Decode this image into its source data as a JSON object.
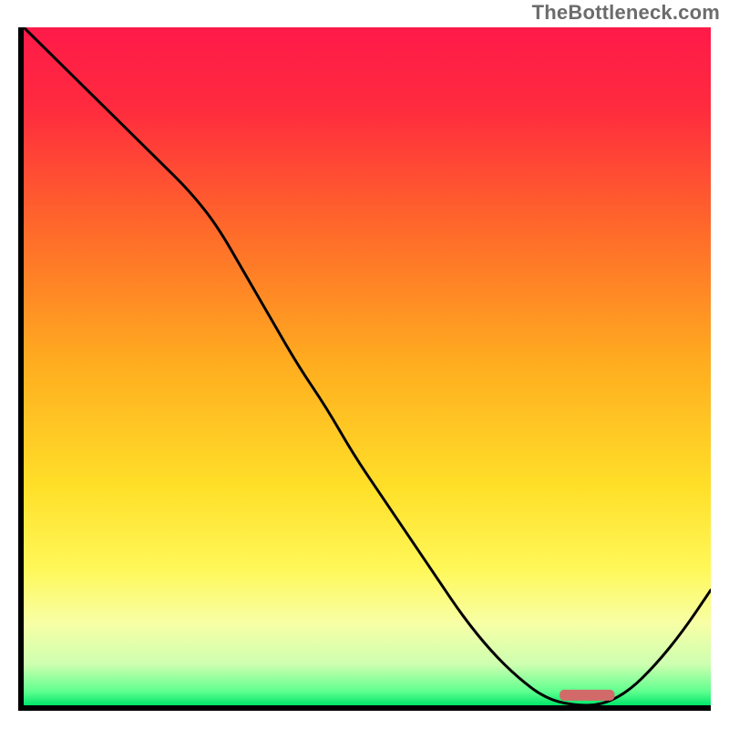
{
  "watermark": "TheBottleneck.com",
  "chart_data": {
    "type": "line",
    "title": "",
    "xlabel": "",
    "ylabel": "",
    "xlim": [
      0,
      100
    ],
    "ylim": [
      0,
      100
    ],
    "x": [
      0,
      4,
      8,
      12,
      16,
      20,
      24,
      28,
      32,
      36,
      40,
      44,
      48,
      52,
      56,
      60,
      64,
      68,
      72,
      76,
      80,
      84,
      88,
      92,
      96,
      100
    ],
    "values": [
      100,
      96,
      92,
      88,
      84,
      80,
      76,
      71,
      64,
      57,
      50,
      44,
      37,
      31,
      25,
      19,
      13,
      8,
      4,
      1,
      0,
      0,
      2,
      6,
      11,
      17
    ],
    "gradient_stops": [
      {
        "pos": 0.0,
        "color": "#ff1a49"
      },
      {
        "pos": 0.12,
        "color": "#ff2b3e"
      },
      {
        "pos": 0.3,
        "color": "#ff6a2a"
      },
      {
        "pos": 0.5,
        "color": "#ffae1f"
      },
      {
        "pos": 0.68,
        "color": "#ffe029"
      },
      {
        "pos": 0.8,
        "color": "#fff85a"
      },
      {
        "pos": 0.88,
        "color": "#f7ffa6"
      },
      {
        "pos": 0.94,
        "color": "#cdffb0"
      },
      {
        "pos": 0.98,
        "color": "#5eff8e"
      },
      {
        "pos": 1.0,
        "color": "#00e66a"
      }
    ],
    "marker_band": {
      "x0": 78,
      "x1": 86,
      "y": 1.5,
      "color": "#d36a6a"
    }
  }
}
